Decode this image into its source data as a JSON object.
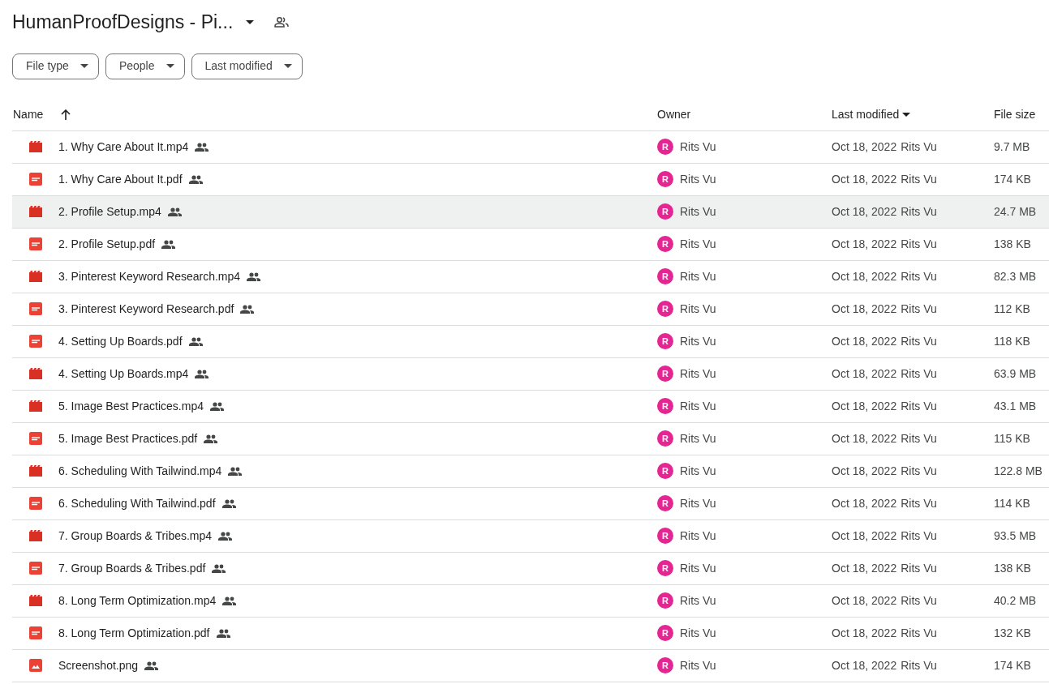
{
  "title": "HumanProofDesigns - Pi...",
  "filters": [
    "File type",
    "People",
    "Last modified"
  ],
  "columns": [
    {
      "label": "Name",
      "sort_arrow": true,
      "menu_caret": false
    },
    {
      "label": "Owner",
      "sort_arrow": false,
      "menu_caret": false
    },
    {
      "label": "Last modified",
      "sort_arrow": false,
      "menu_caret": true
    },
    {
      "label": "File size",
      "sort_arrow": false,
      "menu_caret": false
    }
  ],
  "rows": [
    {
      "kind": "video",
      "name": "1. Why Care About It.mp4",
      "shared": true,
      "owner_initial": "R",
      "owner": "Rits Vu",
      "modified": "Oct 18, 2022",
      "modified_by": "Rits Vu",
      "size": "9.7 MB",
      "selected": false
    },
    {
      "kind": "pdf",
      "name": "1. Why Care About It.pdf",
      "shared": true,
      "owner_initial": "R",
      "owner": "Rits Vu",
      "modified": "Oct 18, 2022",
      "modified_by": "Rits Vu",
      "size": "174 KB",
      "selected": false
    },
    {
      "kind": "video",
      "name": "2. Profile Setup.mp4",
      "shared": true,
      "owner_initial": "R",
      "owner": "Rits Vu",
      "modified": "Oct 18, 2022",
      "modified_by": "Rits Vu",
      "size": "24.7 MB",
      "selected": true
    },
    {
      "kind": "pdf",
      "name": "2. Profile Setup.pdf",
      "shared": true,
      "owner_initial": "R",
      "owner": "Rits Vu",
      "modified": "Oct 18, 2022",
      "modified_by": "Rits Vu",
      "size": "138 KB",
      "selected": false
    },
    {
      "kind": "video",
      "name": "3. Pinterest Keyword Research.mp4",
      "shared": true,
      "owner_initial": "R",
      "owner": "Rits Vu",
      "modified": "Oct 18, 2022",
      "modified_by": "Rits Vu",
      "size": "82.3 MB",
      "selected": false
    },
    {
      "kind": "pdf",
      "name": "3. Pinterest Keyword Research.pdf",
      "shared": true,
      "owner_initial": "R",
      "owner": "Rits Vu",
      "modified": "Oct 18, 2022",
      "modified_by": "Rits Vu",
      "size": "112 KB",
      "selected": false
    },
    {
      "kind": "pdf",
      "name": "4.  Setting Up Boards.pdf",
      "shared": true,
      "owner_initial": "R",
      "owner": "Rits Vu",
      "modified": "Oct 18, 2022",
      "modified_by": "Rits Vu",
      "size": "118 KB",
      "selected": false
    },
    {
      "kind": "video",
      "name": "4. Setting Up Boards.mp4",
      "shared": true,
      "owner_initial": "R",
      "owner": "Rits Vu",
      "modified": "Oct 18, 2022",
      "modified_by": "Rits Vu",
      "size": "63.9 MB",
      "selected": false
    },
    {
      "kind": "video",
      "name": "5. Image Best Practices.mp4",
      "shared": true,
      "owner_initial": "R",
      "owner": "Rits Vu",
      "modified": "Oct 18, 2022",
      "modified_by": "Rits Vu",
      "size": "43.1 MB",
      "selected": false
    },
    {
      "kind": "pdf",
      "name": "5. Image Best Practices.pdf",
      "shared": true,
      "owner_initial": "R",
      "owner": "Rits Vu",
      "modified": "Oct 18, 2022",
      "modified_by": "Rits Vu",
      "size": "115 KB",
      "selected": false
    },
    {
      "kind": "video",
      "name": "6. Scheduling With Tailwind.mp4",
      "shared": true,
      "owner_initial": "R",
      "owner": "Rits Vu",
      "modified": "Oct 18, 2022",
      "modified_by": "Rits Vu",
      "size": "122.8 MB",
      "selected": false
    },
    {
      "kind": "pdf",
      "name": "6. Scheduling With Tailwind.pdf",
      "shared": true,
      "owner_initial": "R",
      "owner": "Rits Vu",
      "modified": "Oct 18, 2022",
      "modified_by": "Rits Vu",
      "size": "114 KB",
      "selected": false
    },
    {
      "kind": "video",
      "name": "7. Group Boards & Tribes.mp4",
      "shared": true,
      "owner_initial": "R",
      "owner": "Rits Vu",
      "modified": "Oct 18, 2022",
      "modified_by": "Rits Vu",
      "size": "93.5 MB",
      "selected": false
    },
    {
      "kind": "pdf",
      "name": "7. Group Boards & Tribes.pdf",
      "shared": true,
      "owner_initial": "R",
      "owner": "Rits Vu",
      "modified": "Oct 18, 2022",
      "modified_by": "Rits Vu",
      "size": "138 KB",
      "selected": false
    },
    {
      "kind": "video",
      "name": "8. Long Term Optimization.mp4",
      "shared": true,
      "owner_initial": "R",
      "owner": "Rits Vu",
      "modified": "Oct 18, 2022",
      "modified_by": "Rits Vu",
      "size": "40.2 MB",
      "selected": false
    },
    {
      "kind": "pdf",
      "name": "8. Long Term Optimization.pdf",
      "shared": true,
      "owner_initial": "R",
      "owner": "Rits Vu",
      "modified": "Oct 18, 2022",
      "modified_by": "Rits Vu",
      "size": "132 KB",
      "selected": false
    },
    {
      "kind": "image",
      "name": "Screenshot.png",
      "shared": true,
      "owner_initial": "R",
      "owner": "Rits Vu",
      "modified": "Oct 18, 2022",
      "modified_by": "Rits Vu",
      "size": "174 KB",
      "selected": false
    }
  ]
}
